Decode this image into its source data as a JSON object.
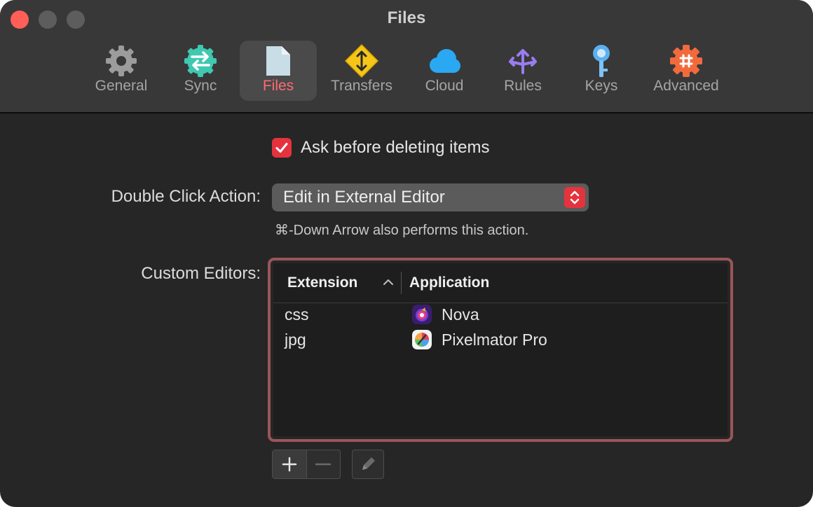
{
  "window": {
    "title": "Files",
    "traffic_lights": [
      "close",
      "minimize",
      "zoom"
    ]
  },
  "toolbar": {
    "selected": "Files",
    "accent_color": "#ff6a72",
    "items": [
      {
        "label": "General",
        "icon": "gear-icon",
        "color": "#9a9a9a"
      },
      {
        "label": "Sync",
        "icon": "sync-arrows-icon",
        "color": "#3ec9b0"
      },
      {
        "label": "Files",
        "icon": "document-icon",
        "color": "#c9dde6"
      },
      {
        "label": "Transfers",
        "icon": "transfers-diamond-icon",
        "color": "#f5c518"
      },
      {
        "label": "Cloud",
        "icon": "cloud-icon",
        "color": "#2aa8f2"
      },
      {
        "label": "Rules",
        "icon": "rules-arrows-icon",
        "color": "#9a7cf0"
      },
      {
        "label": "Keys",
        "icon": "key-icon",
        "color": "#5ab0f0"
      },
      {
        "label": "Advanced",
        "icon": "advanced-gear-icon",
        "color": "#f26a3c"
      }
    ]
  },
  "settings": {
    "ask_before_delete": {
      "label": "Ask before deleting items",
      "checked": true
    },
    "double_click": {
      "label": "Double Click Action:",
      "selected_value": "Edit in External Editor",
      "hint": "⌘-Down Arrow also performs this action."
    },
    "custom_editors": {
      "label": "Custom Editors:",
      "columns": {
        "extension": "Extension",
        "application": "Application"
      },
      "sort_column": "Extension",
      "sort_direction": "ascending",
      "rows": [
        {
          "extension": "css",
          "application": "Nova",
          "icon": "nova-app-icon"
        },
        {
          "extension": "jpg",
          "application": "Pixelmator Pro",
          "icon": "pixelmator-app-icon"
        }
      ],
      "buttons": {
        "add": "+",
        "remove": "−",
        "edit": "pencil-icon"
      }
    }
  },
  "colors": {
    "checkbox": "#e5333e",
    "focus_ring": "#9a5558",
    "close_button": "#ff5f57"
  }
}
